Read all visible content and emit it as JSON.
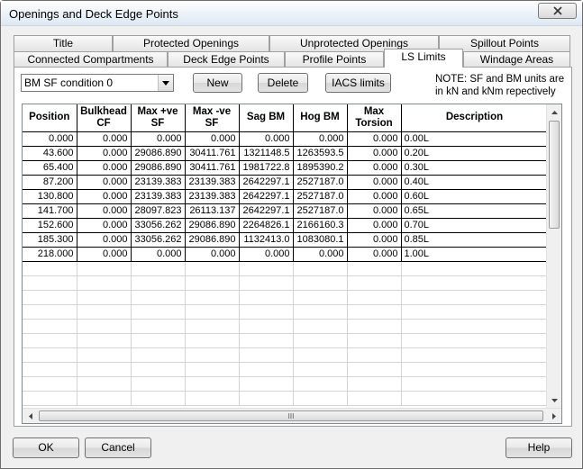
{
  "window": {
    "title": "Openings and Deck Edge Points"
  },
  "tabs_row1": [
    "Title",
    "Protected Openings",
    "Unprotected Openings",
    "Spillout Points"
  ],
  "tabs_row2": [
    "Connected Compartments",
    "Deck Edge Points",
    "Profile Points",
    "LS Limits",
    "Windage Areas"
  ],
  "active_tab": "LS Limits",
  "condition_select": {
    "value": "BM SF condition 0"
  },
  "buttons": {
    "new": "New",
    "delete": "Delete",
    "iacs": "IACS limits",
    "ok": "OK",
    "cancel": "Cancel",
    "help": "Help"
  },
  "note": "NOTE: SF and BM units are in kN and kNm repectively",
  "table": {
    "headers": [
      "Position",
      "Bulkhead CF",
      "Max +ve SF",
      "Max -ve SF",
      "Sag BM",
      "Hog BM",
      "Max Torsion",
      "Description"
    ],
    "rows": [
      [
        "0.000",
        "0.000",
        "0.000",
        "0.000",
        "0.000",
        "0.000",
        "0.000",
        "0.00L"
      ],
      [
        "43.600",
        "0.000",
        "29086.890",
        "30411.761",
        "1321148.5",
        "1263593.5",
        "0.000",
        "0.20L"
      ],
      [
        "65.400",
        "0.000",
        "29086.890",
        "30411.761",
        "1981722.8",
        "1895390.2",
        "0.000",
        "0.30L"
      ],
      [
        "87.200",
        "0.000",
        "23139.383",
        "23139.383",
        "2642297.1",
        "2527187.0",
        "0.000",
        "0.40L"
      ],
      [
        "130.800",
        "0.000",
        "23139.383",
        "23139.383",
        "2642297.1",
        "2527187.0",
        "0.000",
        "0.60L"
      ],
      [
        "141.700",
        "0.000",
        "28097.823",
        "26113.137",
        "2642297.1",
        "2527187.0",
        "0.000",
        "0.65L"
      ],
      [
        "152.600",
        "0.000",
        "33056.262",
        "29086.890",
        "2264826.1",
        "2166160.3",
        "0.000",
        "0.70L"
      ],
      [
        "185.300",
        "0.000",
        "33056.262",
        "29086.890",
        "1132413.0",
        "1083080.1",
        "0.000",
        "0.85L"
      ],
      [
        "218.000",
        "0.000",
        "0.000",
        "0.000",
        "0.000",
        "0.000",
        "0.000",
        "1.00L"
      ]
    ],
    "empty_rows": 10
  },
  "icons": {
    "close": "close-icon",
    "dropdown": "chevron-down-icon",
    "scroll_up": "arrow-up-icon",
    "scroll_down": "arrow-down-icon",
    "scroll_left": "arrow-left-icon",
    "scroll_right": "arrow-right-icon",
    "grip": "grip-icon"
  },
  "grip_text": "III"
}
